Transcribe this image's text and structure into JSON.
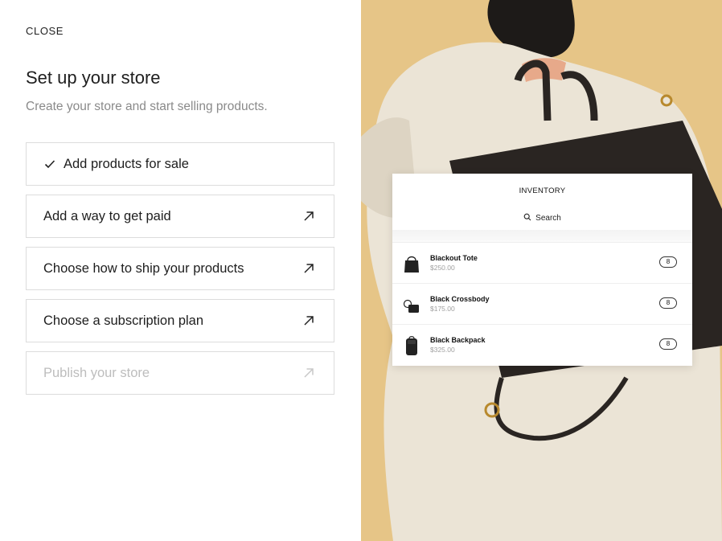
{
  "header": {
    "close_label": "CLOSE"
  },
  "main": {
    "title": "Set up your store",
    "subtitle": "Create your store and start selling products.",
    "steps": [
      {
        "label": "Add products for sale",
        "state": "completed",
        "icon": "check-icon"
      },
      {
        "label": "Add a way to get paid",
        "state": "active",
        "icon": "arrow-up-right-icon"
      },
      {
        "label": "Choose how to ship your products",
        "state": "active",
        "icon": "arrow-up-right-icon"
      },
      {
        "label": "Choose a subscription plan",
        "state": "active",
        "icon": "arrow-up-right-icon"
      },
      {
        "label": "Publish your store",
        "state": "disabled",
        "icon": "arrow-up-right-icon"
      }
    ]
  },
  "inventory": {
    "title": "INVENTORY",
    "search_label": "Search",
    "items": [
      {
        "name": "Blackout Tote",
        "price": "$250.00",
        "qty": "8"
      },
      {
        "name": "Black Crossbody",
        "price": "$175.00",
        "qty": "8"
      },
      {
        "name": "Black Backpack",
        "price": "$325.00",
        "qty": "8"
      }
    ]
  },
  "colors": {
    "text": "#1e1e1e",
    "muted": "#8a8a8a",
    "border": "#dcdcdc",
    "disabled": "#bdbdbd",
    "photo_background": "#e8c98c",
    "coat": "#ebe4d6",
    "bag": "#2a2522"
  }
}
